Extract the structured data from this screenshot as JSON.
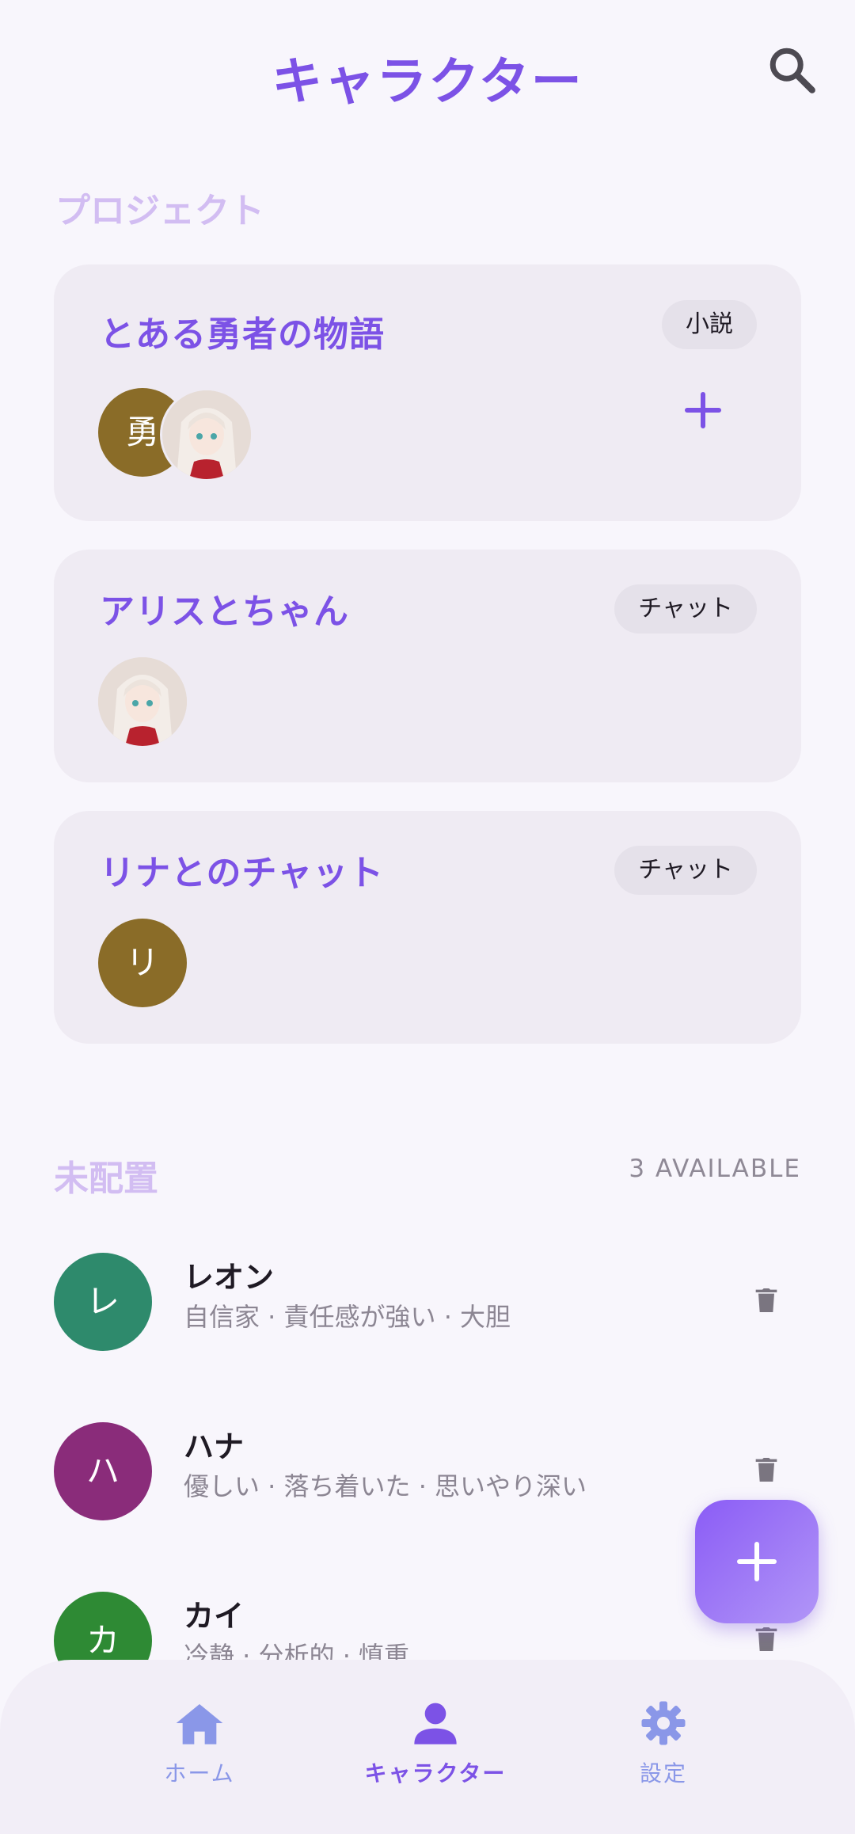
{
  "header": {
    "title": "キャラクター"
  },
  "projects": {
    "section_label": "プロジェクト",
    "cards": [
      {
        "title": "とある勇者の物語",
        "badge": "小説",
        "avatars": [
          {
            "type": "initial",
            "text": "勇",
            "color": "#8a6c28"
          },
          {
            "type": "photo",
            "description": "anime-girl-portrait"
          }
        ],
        "has_add_button": true
      },
      {
        "title": "アリスとちゃん",
        "badge": "チャット",
        "avatars": [
          {
            "type": "photo",
            "description": "anime-girl-portrait"
          }
        ]
      },
      {
        "title": "リナとのチャット",
        "badge": "チャット",
        "avatars": [
          {
            "type": "initial",
            "text": "リ",
            "color": "#8a6c28"
          }
        ]
      }
    ]
  },
  "unassigned": {
    "section_label": "未配置",
    "available_text": "3 AVAILABLE",
    "characters": [
      {
        "initial": "レ",
        "name": "レオン",
        "traits": "自信家 · 責任感が強い · 大胆",
        "color": "#2e8a6c"
      },
      {
        "initial": "ハ",
        "name": "ハナ",
        "traits": "優しい · 落ち着いた · 思いやり深い",
        "color": "#8a2c7a"
      },
      {
        "initial": "カ",
        "name": "カイ",
        "traits": "冷静 · 分析的 · 慎重",
        "color": "#2e8a34"
      }
    ]
  },
  "bottom_nav": {
    "items": [
      {
        "label": "ホーム",
        "icon": "home-icon",
        "active": false
      },
      {
        "label": "キャラクター",
        "icon": "person-icon",
        "active": true
      },
      {
        "label": "設定",
        "icon": "gear-icon",
        "active": false
      }
    ]
  },
  "colors": {
    "accent": "#7c52e6",
    "section_label": "#d2bdf2",
    "card_bg": "#efebf3",
    "badge_bg": "#e5e1ea",
    "nav_inactive": "#8a97e8"
  }
}
